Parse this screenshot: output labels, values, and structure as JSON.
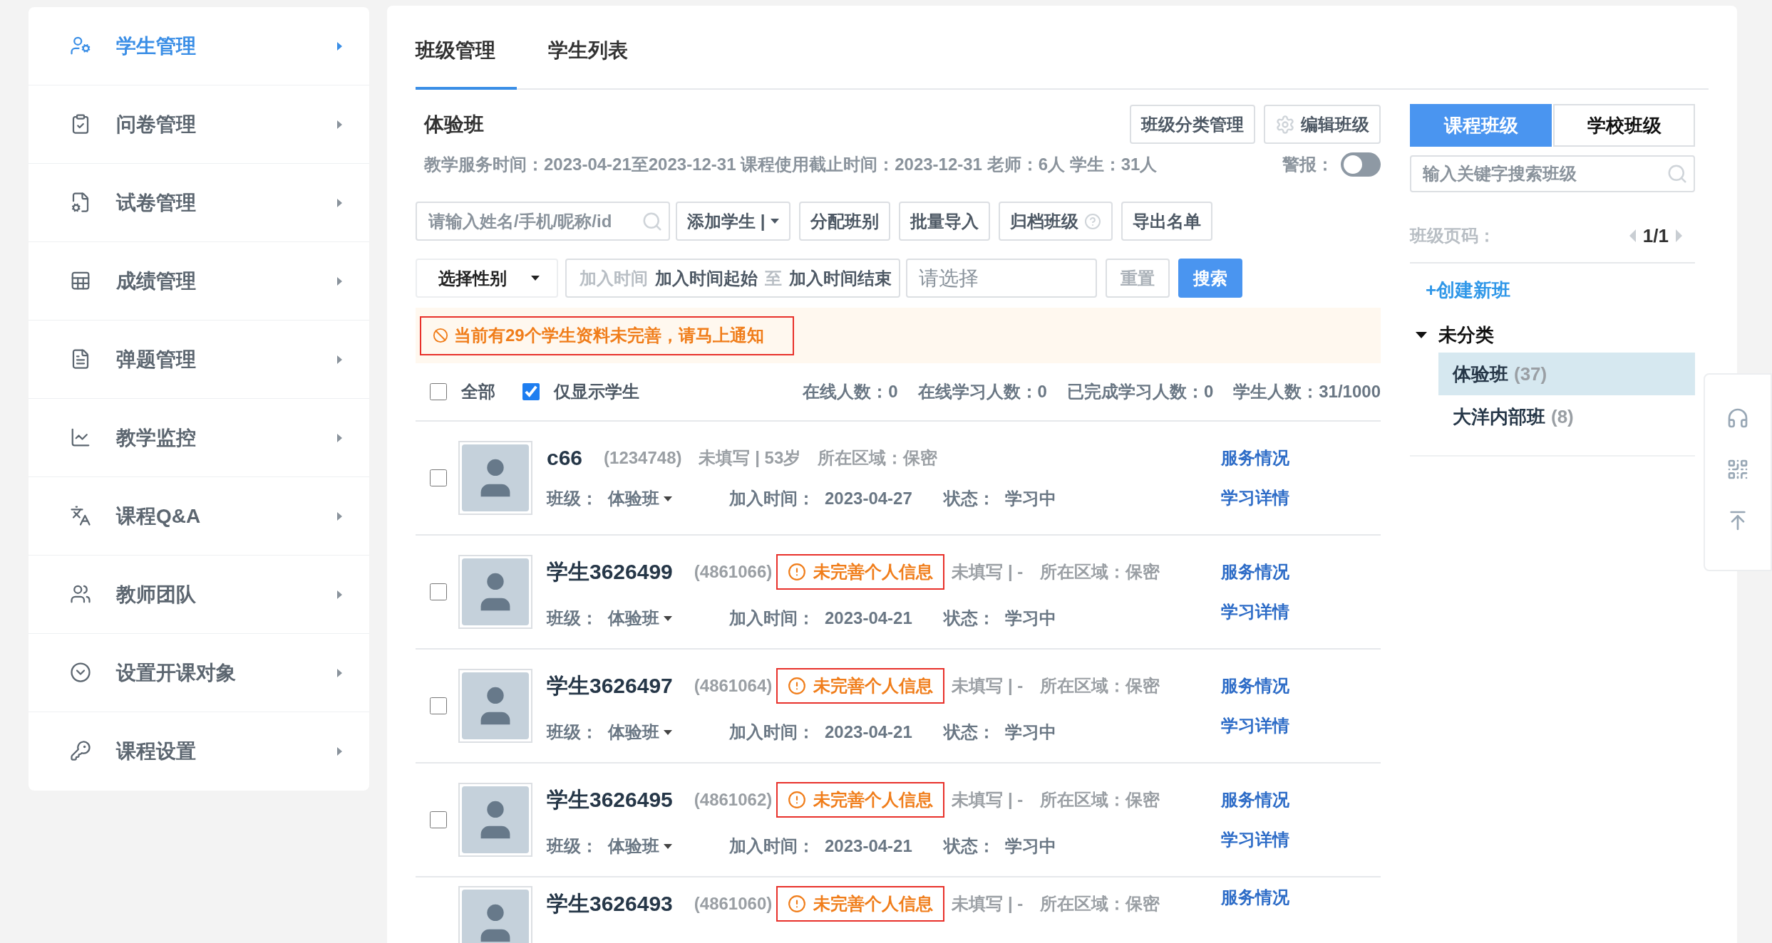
{
  "sidebar": {
    "items": [
      {
        "label": "学生管理",
        "selected": true
      },
      {
        "label": "问卷管理",
        "selected": false
      },
      {
        "label": "试卷管理",
        "selected": false
      },
      {
        "label": "成绩管理",
        "selected": false
      },
      {
        "label": "弹题管理",
        "selected": false
      },
      {
        "label": "教学监控",
        "selected": false
      },
      {
        "label": "课程Q&A",
        "selected": false
      },
      {
        "label": "教师团队",
        "selected": false
      },
      {
        "label": "设置开课对象",
        "selected": false
      },
      {
        "label": "课程设置",
        "selected": false
      }
    ]
  },
  "tabs": [
    {
      "label": "班级管理",
      "selected": true
    },
    {
      "label": "学生列表",
      "selected": false
    }
  ],
  "class_header": {
    "title": "体验班",
    "info": "教学服务时间：2023-04-21至2023-12-31 课程使用截止时间：2023-12-31 老师：6人 学生：31人",
    "buttons": [
      {
        "label": "班级分类管理",
        "kind": "plain"
      },
      {
        "label": "编辑班级",
        "kind": "gear"
      }
    ],
    "alarm": {
      "label": "警报：",
      "on": false
    }
  },
  "toolbar": {
    "search_placeholder": "请输入姓名/手机/昵称/id",
    "buttons": [
      {
        "label": "添加学生 |",
        "kind": "dropdown"
      },
      {
        "label": "分配班别",
        "kind": "plain"
      },
      {
        "label": "批量导入",
        "kind": "plain"
      },
      {
        "label": "归档班级",
        "kind": "help"
      },
      {
        "label": "导出名单",
        "kind": "plain"
      }
    ]
  },
  "filters": {
    "gender": "选择性别",
    "date_label": "加入时间",
    "date_start": "加入时间起始",
    "date_sep": "至",
    "date_end": "加入时间结束",
    "select_placeholder": "请选择",
    "reset": "重置",
    "search": "搜索"
  },
  "alert": "当前有29个学生资料未完善，请马上通知",
  "list_header": {
    "all": {
      "label": "全部",
      "checked": false
    },
    "only_students": {
      "label": "仅显示学生",
      "checked": true
    },
    "stats": [
      "在线人数：0",
      "在线学习人数：0",
      "已完成学习人数：0",
      "学生人数：31/1000"
    ]
  },
  "students": [
    {
      "checked": false,
      "name": "c66",
      "id": "(1234748)",
      "incomplete": false,
      "info": "未填写 | 53岁",
      "region": "所在区域：保密",
      "class_label": "班级：",
      "class": "体验班",
      "join_label": "加入时间：",
      "join": "2023-04-27",
      "status_label": "状态：",
      "status": "学习中",
      "links": [
        "服务情况",
        "学习详情"
      ]
    },
    {
      "checked": false,
      "name": "学生3626499",
      "id": "(4861066)",
      "incomplete": true,
      "badge": "未完善个人信息",
      "info": "未填写 | -",
      "region": "所在区域：保密",
      "class_label": "班级：",
      "class": "体验班",
      "join_label": "加入时间：",
      "join": "2023-04-21",
      "status_label": "状态：",
      "status": "学习中",
      "links": [
        "服务情况",
        "学习详情"
      ]
    },
    {
      "checked": false,
      "name": "学生3626497",
      "id": "(4861064)",
      "incomplete": true,
      "badge": "未完善个人信息",
      "info": "未填写 | -",
      "region": "所在区域：保密",
      "class_label": "班级：",
      "class": "体验班",
      "join_label": "加入时间：",
      "join": "2023-04-21",
      "status_label": "状态：",
      "status": "学习中",
      "links": [
        "服务情况",
        "学习详情"
      ]
    },
    {
      "checked": false,
      "name": "学生3626495",
      "id": "(4861062)",
      "incomplete": true,
      "badge": "未完善个人信息",
      "info": "未填写 | -",
      "region": "所在区域：保密",
      "class_label": "班级：",
      "class": "体验班",
      "join_label": "加入时间：",
      "join": "2023-04-21",
      "status_label": "状态：",
      "status": "学习中",
      "links": [
        "服务情况",
        "学习详情"
      ]
    },
    {
      "name": "学生3626493",
      "id": "(4861060)",
      "incomplete": true,
      "badge": "未完善个人信息",
      "info": "未填写 | -",
      "region": "所在区域：保密",
      "links": [
        "服务情况"
      ]
    }
  ],
  "right_panel": {
    "tabs": [
      {
        "label": "课程班级",
        "selected": true
      },
      {
        "label": "学校班级",
        "selected": false
      }
    ],
    "search_placeholder": "输入关键字搜索班级",
    "page_label": "班级页码：",
    "page": "1/1",
    "create": "+创建新班",
    "tree": [
      {
        "label": "未分类",
        "expanded": true,
        "children": [
          {
            "label": "体验班",
            "count": "(37)",
            "selected": true
          },
          {
            "label": "大洋内部班",
            "count": "(8)",
            "selected": false
          }
        ]
      }
    ]
  }
}
